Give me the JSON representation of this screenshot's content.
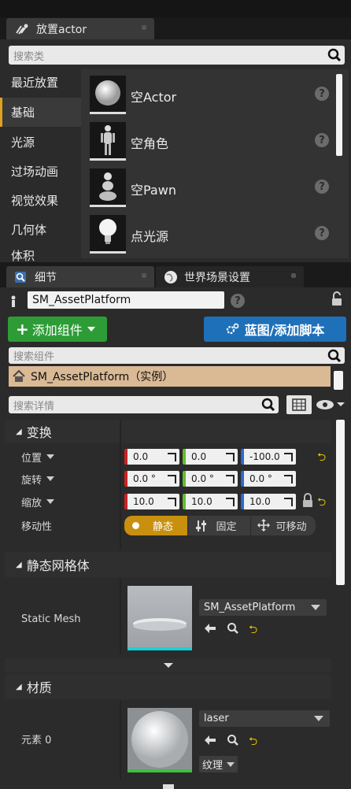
{
  "place_actor": {
    "tab_title": "放置actor",
    "search_placeholder": "搜索类",
    "categories": [
      "最近放置",
      "基础",
      "光源",
      "过场动画",
      "视觉效果",
      "几何体",
      "体积"
    ],
    "items": [
      "空Actor",
      "空角色",
      "空Pawn",
      "点光源"
    ],
    "help_glyph": "?"
  },
  "details_tab": {
    "title": "细节",
    "world_settings_title": "世界场景设置"
  },
  "actor": {
    "name": "SM_AssetPlatform",
    "add_component_label": "添加组件",
    "blueprint_label": "蓝图/添加脚本",
    "search_components_placeholder": "搜索组件",
    "component_instance": "SM_AssetPlatform（实例）",
    "search_details_placeholder": "搜索详情"
  },
  "transform": {
    "section_title": "变换",
    "location_label": "位置",
    "rotation_label": "旋转",
    "scale_label": "缩放",
    "mobility_label": "移动性",
    "location": [
      "0.0",
      "0.0",
      "-100.0"
    ],
    "rotation": [
      "0.0 °",
      "0.0 °",
      "0.0 °"
    ],
    "scale": [
      "10.0",
      "10.0",
      "10.0"
    ],
    "mobility_options": [
      "静态",
      "固定",
      "可移动"
    ]
  },
  "static_mesh": {
    "section_title": "静态网格体",
    "label": "Static Mesh",
    "value": "SM_AssetPlatform"
  },
  "materials": {
    "section_title": "材质",
    "element_label": "元素 0",
    "value": "laser",
    "texture_label": "纹理"
  },
  "colors": {
    "accent_orange": "#e0a020",
    "add_green": "#2e9c36",
    "blueprint_blue": "#1e70b8",
    "x_red": "#cc2222",
    "y_green": "#5fbf2c",
    "z_blue": "#2a6ad0",
    "mobility_static": "#c8900e"
  }
}
